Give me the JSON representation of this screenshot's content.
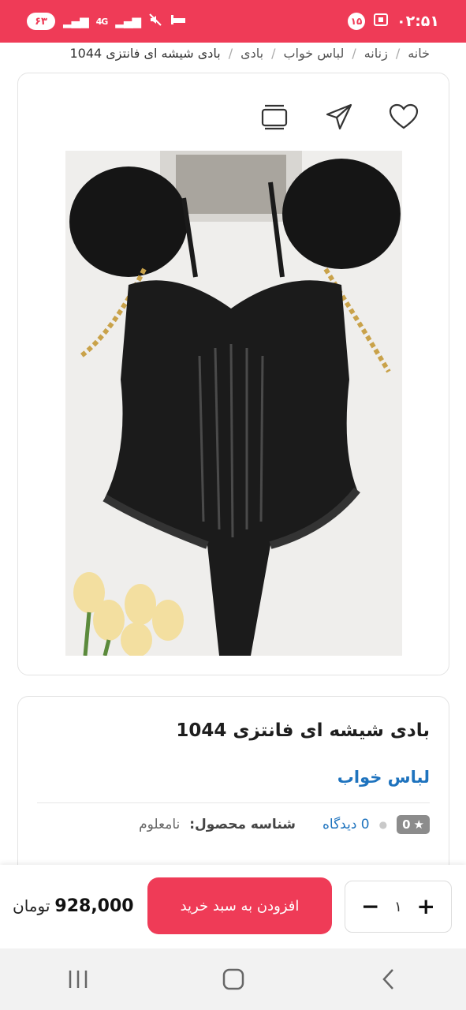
{
  "status_bar": {
    "time": "۰۲:۵۱",
    "notification_count": "۱۵",
    "battery": "۶۳",
    "network": "4G"
  },
  "breadcrumb": {
    "items": [
      "خانه",
      "زنانه",
      "لباس خواب",
      "بادی"
    ],
    "current": "بادی شیشه ای فانتزی 1044",
    "separator": "/"
  },
  "product": {
    "title": "بادی شیشه ای فانتزی 1044",
    "category": "لباس خواب",
    "rating": "0",
    "views": "0 دیدگاه",
    "sku_label": "شناسه محصول:",
    "sku_value": "نامعلوم"
  },
  "cart": {
    "quantity": "۱",
    "add_label": "افزودن به سبد خرید",
    "price": "928,000",
    "currency": "تومان"
  },
  "colors": {
    "brand": "#ef3b57",
    "link": "#1e73be"
  }
}
